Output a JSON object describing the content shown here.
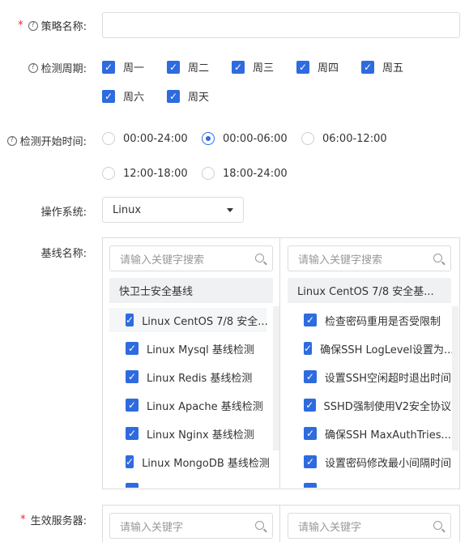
{
  "policy_name": {
    "label": "策略名称:",
    "value": ""
  },
  "cycle": {
    "label": "检测周期:",
    "days": [
      "周一",
      "周二",
      "周三",
      "周四",
      "周五",
      "周六",
      "周天"
    ]
  },
  "start_time": {
    "label": "检测开始时间:",
    "options": [
      "00:00-24:00",
      "00:00-06:00",
      "06:00-12:00",
      "12:00-18:00",
      "18:00-24:00"
    ],
    "selected": "00:00-06:00"
  },
  "os": {
    "label": "操作系统:",
    "value": "Linux"
  },
  "baseline": {
    "label": "基线名称:",
    "left": {
      "placeholder": "请输入关键字搜索",
      "group": "快卫士安全基线",
      "items": [
        "Linux CentOS 7/8 安全...",
        "Linux Mysql 基线检测",
        "Linux Redis 基线检测",
        "Linux Apache 基线检测",
        "Linux Nginx 基线检测",
        "Linux MongoDB 基线检测"
      ]
    },
    "right": {
      "placeholder": "请输入关键字搜索",
      "group": "Linux CentOS 7/8 安全基...",
      "items": [
        "检查密码重用是否受限制",
        "确保SSH LogLevel设置为...",
        "设置SSH空闲超时退出时间",
        "SSHD强制使用V2安全协议",
        "确保SSH MaxAuthTries...",
        "设置密码修改最小间隔时间"
      ]
    }
  },
  "servers": {
    "label": "生效服务器:",
    "left_placeholder": "请输入关键字",
    "right_placeholder": "请输入关键字"
  },
  "colors": {
    "accent": "#2e6bdf",
    "required": "#f5222d",
    "group_bg": "#f0f1f3"
  }
}
